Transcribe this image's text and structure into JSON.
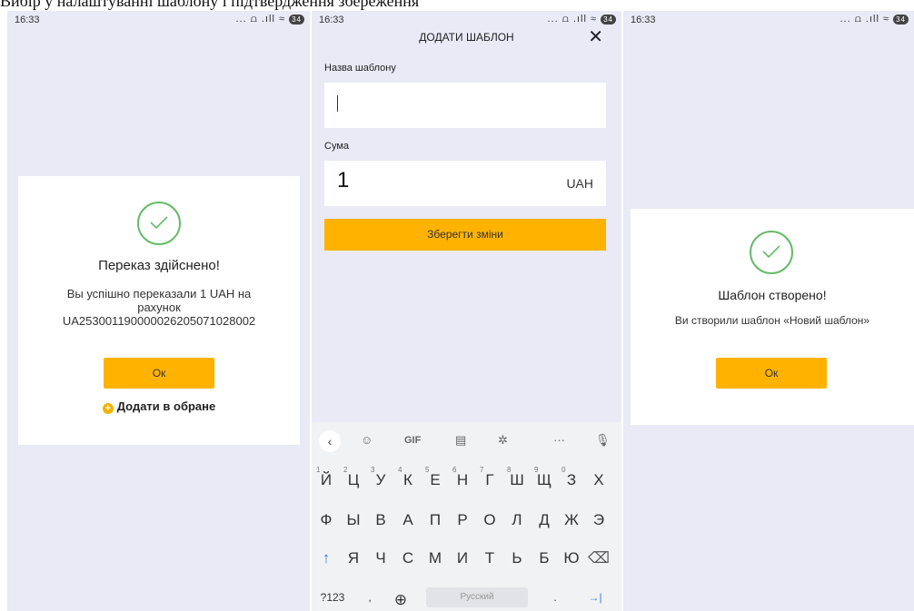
{
  "caption": "Вибір у налаштуванні шаблону і підтвердження збереження",
  "status": {
    "time": "16:33",
    "icons": "... ⩍ .ıll ≈",
    "battery": "34"
  },
  "screen1": {
    "title": "Переказ здійснено!",
    "line1": "Вы успішно переказали 1 UAH на",
    "line2": "рахунок",
    "line3": "UA253001190000026205071028002",
    "ok_label": "Ок",
    "fav_label": "Додати в обране",
    "fav_icon": "+"
  },
  "screen2": {
    "header": "ДОДАТИ ШАБЛОН",
    "close": "✕",
    "name_label": "Назва шаблону",
    "amount_label": "Сума",
    "amount_value": "1",
    "currency": "UAH",
    "save_label": "Зберегти зміни",
    "keyboard": {
      "toolbar": {
        "back": "‹",
        "emoji": "☺",
        "gif": "GIF",
        "clipboard": "▤",
        "settings": "✲",
        "more": "···",
        "mic": "🎙"
      },
      "row1": [
        "Й",
        "Ц",
        "У",
        "К",
        "Е",
        "Н",
        "Г",
        "Ш",
        "Щ",
        "З",
        "Х"
      ],
      "row1_nums": [
        "1",
        "2",
        "3",
        "4",
        "5",
        "6",
        "7",
        "8",
        "9",
        "0"
      ],
      "row2": [
        "Ф",
        "Ы",
        "В",
        "А",
        "П",
        "Р",
        "О",
        "Л",
        "Д",
        "Ж",
        "Э"
      ],
      "row3": [
        "Я",
        "Ч",
        "С",
        "М",
        "И",
        "Т",
        "Ь",
        "Б",
        "Ю"
      ],
      "shift": "↑",
      "backspace": "⌫",
      "symbols": "?123",
      "comma": ",",
      "globe": "⊕",
      "space": "Русский",
      "period": ".",
      "enter": "→|"
    }
  },
  "screen3": {
    "title": "Шаблон створено!",
    "text": "Ви створили шаблон «Новий шаблон»",
    "ok_label": "Ок"
  },
  "colors": {
    "accent": "#ffb300",
    "success": "#66bb6a",
    "background": "#e9eaf6"
  }
}
